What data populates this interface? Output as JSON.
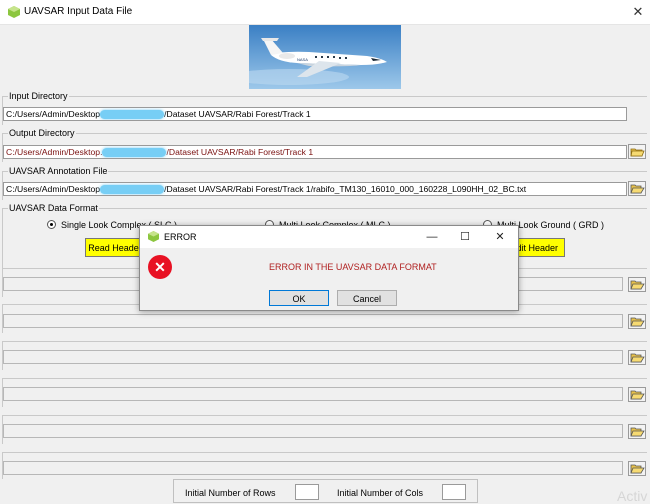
{
  "window": {
    "title": "UAVSAR Input Data File",
    "close": "✕"
  },
  "input_directory": {
    "label": "Input Directory",
    "path_prefix": "C:/Users/Admin/Desktop",
    "path_suffix": "/Dataset UAVSAR/Rabi Forest/Track 1"
  },
  "output_directory": {
    "label": "Output Directory",
    "path_prefix": "C:/Users/Admin/Desktop.",
    "path_suffix": "/Dataset UAVSAR/Rabi Forest/Track 1"
  },
  "annotation_file": {
    "label": "UAVSAR Annotation File",
    "path_prefix": "C:/Users/Admin/Desktop",
    "path_suffix": "/Dataset UAVSAR/Rabi Forest/Track 1/rabifo_TM130_16010_000_160228_L090HH_02_BC.txt"
  },
  "data_format": {
    "label": "UAVSAR Data Format",
    "options": [
      {
        "label": "Single Look Complex ( SLC )",
        "selected": true
      },
      {
        "label": "Multi Look Complex ( MLC )",
        "selected": false
      },
      {
        "label": "Multi Look Ground ( GRD )",
        "selected": false
      }
    ],
    "read_header": "Read Header",
    "edit_header": "dit Header"
  },
  "bottom": {
    "rows_label": "Initial Number of Rows",
    "cols_label": "Initial Number of Cols"
  },
  "watermark": "Activ",
  "dialog": {
    "title": "ERROR",
    "minimize": "—",
    "maximize": "☐",
    "close": "✕",
    "message": "ERROR IN THE UAVSAR DATA FORMAT",
    "ok": "OK",
    "cancel": "Cancel",
    "error_glyph": "✕"
  },
  "colors": {
    "read_header_bg": "#ffff00",
    "error_text": "#b02020",
    "error_icon": "#e81123",
    "path_red": "#7a1010"
  }
}
